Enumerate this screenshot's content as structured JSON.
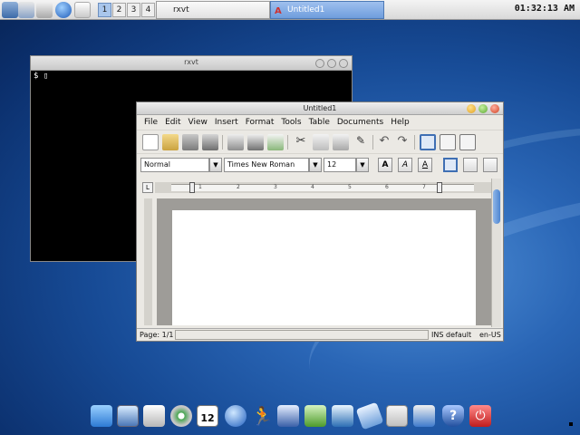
{
  "top_panel": {
    "launchers": [
      "computer-icon",
      "upload-icon",
      "volume-icon",
      "globe-icon",
      "search-icon"
    ],
    "workspaces": [
      "1",
      "2",
      "3",
      "4"
    ],
    "tasks": [
      {
        "label": "rxvt"
      },
      {
        "label": "Untitled1"
      }
    ],
    "clock": "01:32:13 AM"
  },
  "rxvt": {
    "title": "rxvt",
    "prompt": "$ ▯"
  },
  "abiword": {
    "title": "Untitled1",
    "menus": [
      "File",
      "Edit",
      "View",
      "Insert",
      "Format",
      "Tools",
      "Table",
      "Documents",
      "Help"
    ],
    "style_value": "Normal",
    "font_value": "Times New Roman",
    "size_value": "12",
    "format_buttons": [
      "A",
      "A",
      "A"
    ],
    "ruler_numbers": [
      "1",
      "2",
      "3",
      "4",
      "5",
      "6",
      "7"
    ],
    "status": {
      "page": "Page: 1/1",
      "mode": "INS",
      "style": "default",
      "lang": "en-US"
    }
  },
  "dock": {
    "items": [
      "finder-icon",
      "monitor-icon",
      "cleanup-icon",
      "disc-icon",
      "calendar-icon",
      "network-globe-icon",
      "runner-icon",
      "document-icon",
      "window-icon",
      "terminal-icon",
      "usb-icon",
      "waveform-icon",
      "download-icon",
      "help-icon",
      "power-icon"
    ],
    "calendar_day": "12"
  }
}
